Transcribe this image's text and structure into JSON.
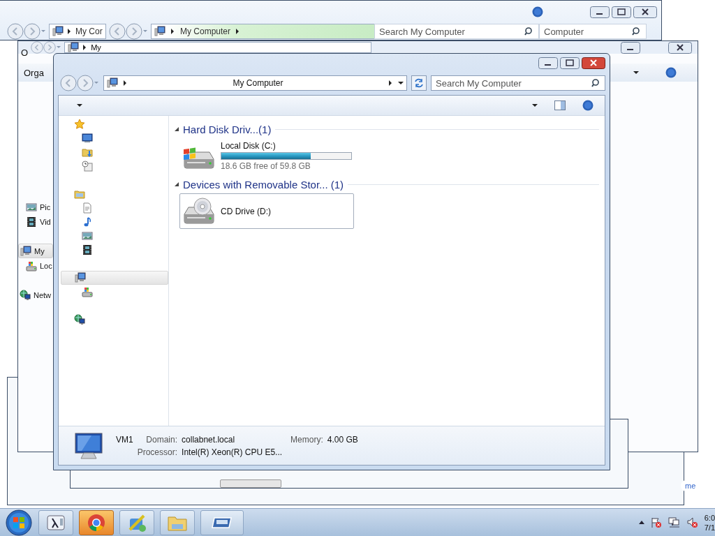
{
  "background_window_1": {
    "address": "My Cor",
    "breadcrumb": "My Computer",
    "search_placeholder": "Search My Computer",
    "search_overlap": "Computer"
  },
  "background_window_2": {
    "toolbar_fragment": "O",
    "address": "My",
    "organize_fragment": "Orga",
    "nav_items": [
      {
        "label": "Pic",
        "kind": "pictures",
        "selected": false
      },
      {
        "label": "Vid",
        "kind": "videos",
        "selected": false
      },
      {
        "label": "My",
        "kind": "computer",
        "selected": true,
        "children": [
          {
            "label": "Loc",
            "kind": "local-disk",
            "selected": false
          }
        ]
      },
      {
        "label": "Netw",
        "kind": "network",
        "selected": false
      }
    ],
    "link_fragment": "me"
  },
  "window": {
    "breadcrumb": "My Computer",
    "search_placeholder": "Search My Computer"
  },
  "nav_pane": [
    {
      "kind": "favorites",
      "selected": false,
      "children": [
        {
          "kind": "desktop",
          "selected": false
        },
        {
          "kind": "downloads",
          "selected": false
        },
        {
          "kind": "recent",
          "selected": false
        }
      ]
    },
    {
      "kind": "libraries",
      "selected": false,
      "children": [
        {
          "kind": "documents",
          "selected": false
        },
        {
          "kind": "music",
          "selected": false
        },
        {
          "kind": "pictures",
          "selected": false
        },
        {
          "kind": "videos",
          "selected": false
        }
      ]
    },
    {
      "kind": "computer",
      "selected": true,
      "children": [
        {
          "kind": "local-disk",
          "selected": false
        }
      ]
    },
    {
      "kind": "network",
      "selected": false
    }
  ],
  "groups": [
    {
      "title": "Hard Disk Driv...(1)",
      "expanded": true,
      "items": [
        {
          "kind": "disk",
          "name": "Local Disk (C:)",
          "level": 0.69,
          "free": "18.6 GB free of 59.8 GB",
          "selected": false
        }
      ]
    },
    {
      "title": "Devices with Removable Stor... (1)",
      "expanded": true,
      "items": [
        {
          "kind": "cd",
          "name": "CD Drive (D:)",
          "selected": true
        }
      ]
    }
  ],
  "details": {
    "name": "VM1",
    "fields": [
      {
        "label": "Domain:",
        "value": "collabnet.local"
      },
      {
        "label": "Memory:",
        "value": "4.00 GB"
      },
      {
        "label": "Processor:",
        "value": "Intel(R) Xeon(R) CPU E5..."
      }
    ]
  },
  "taskbar": {
    "buttons": [
      {
        "kind": "lambda",
        "highlighted": false
      },
      {
        "kind": "browser",
        "highlighted": true
      },
      {
        "kind": "tools",
        "highlighted": false
      },
      {
        "kind": "explorer",
        "highlighted": false
      },
      {
        "kind": "remote",
        "highlighted": false
      }
    ],
    "tray": [
      {
        "kind": "flag"
      },
      {
        "kind": "network"
      },
      {
        "kind": "speaker"
      }
    ],
    "time": "6:0",
    "date": "7/1"
  }
}
